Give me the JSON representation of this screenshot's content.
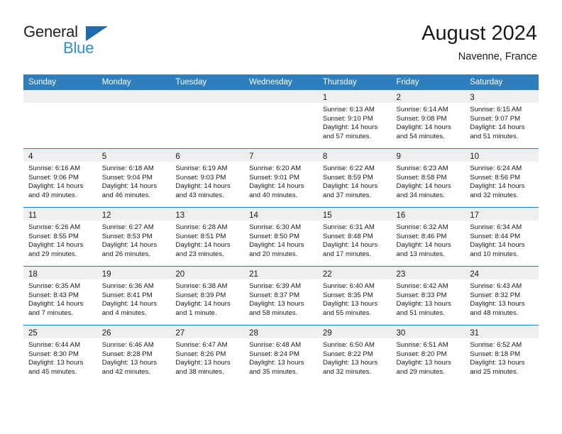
{
  "brand": {
    "name_part1": "General",
    "name_part2": "Blue",
    "triangle_color": "#1f6bb0",
    "blue_text_color": "#2e8fd6"
  },
  "header": {
    "title": "August 2024",
    "subtitle": "Navenne, France"
  },
  "theme": {
    "header_row_bg": "#2e7ebd",
    "daynum_band_bg": "#efefef",
    "grid_line": "#2e7ebd",
    "text": "#1a1a1a"
  },
  "weekday_headers": [
    "Sunday",
    "Monday",
    "Tuesday",
    "Wednesday",
    "Thursday",
    "Friday",
    "Saturday"
  ],
  "weeks": [
    [
      {
        "day": "",
        "empty": true,
        "sunrise": "",
        "sunset": "",
        "daylight_l1": "",
        "daylight_l2": ""
      },
      {
        "day": "",
        "empty": true,
        "sunrise": "",
        "sunset": "",
        "daylight_l1": "",
        "daylight_l2": ""
      },
      {
        "day": "",
        "empty": true,
        "sunrise": "",
        "sunset": "",
        "daylight_l1": "",
        "daylight_l2": ""
      },
      {
        "day": "",
        "empty": true,
        "sunrise": "",
        "sunset": "",
        "daylight_l1": "",
        "daylight_l2": ""
      },
      {
        "day": "1",
        "empty": false,
        "sunrise": "Sunrise: 6:13 AM",
        "sunset": "Sunset: 9:10 PM",
        "daylight_l1": "Daylight: 14 hours",
        "daylight_l2": "and 57 minutes."
      },
      {
        "day": "2",
        "empty": false,
        "sunrise": "Sunrise: 6:14 AM",
        "sunset": "Sunset: 9:08 PM",
        "daylight_l1": "Daylight: 14 hours",
        "daylight_l2": "and 54 minutes."
      },
      {
        "day": "3",
        "empty": false,
        "sunrise": "Sunrise: 6:15 AM",
        "sunset": "Sunset: 9:07 PM",
        "daylight_l1": "Daylight: 14 hours",
        "daylight_l2": "and 51 minutes."
      }
    ],
    [
      {
        "day": "4",
        "empty": false,
        "sunrise": "Sunrise: 6:16 AM",
        "sunset": "Sunset: 9:06 PM",
        "daylight_l1": "Daylight: 14 hours",
        "daylight_l2": "and 49 minutes."
      },
      {
        "day": "5",
        "empty": false,
        "sunrise": "Sunrise: 6:18 AM",
        "sunset": "Sunset: 9:04 PM",
        "daylight_l1": "Daylight: 14 hours",
        "daylight_l2": "and 46 minutes."
      },
      {
        "day": "6",
        "empty": false,
        "sunrise": "Sunrise: 6:19 AM",
        "sunset": "Sunset: 9:03 PM",
        "daylight_l1": "Daylight: 14 hours",
        "daylight_l2": "and 43 minutes."
      },
      {
        "day": "7",
        "empty": false,
        "sunrise": "Sunrise: 6:20 AM",
        "sunset": "Sunset: 9:01 PM",
        "daylight_l1": "Daylight: 14 hours",
        "daylight_l2": "and 40 minutes."
      },
      {
        "day": "8",
        "empty": false,
        "sunrise": "Sunrise: 6:22 AM",
        "sunset": "Sunset: 8:59 PM",
        "daylight_l1": "Daylight: 14 hours",
        "daylight_l2": "and 37 minutes."
      },
      {
        "day": "9",
        "empty": false,
        "sunrise": "Sunrise: 6:23 AM",
        "sunset": "Sunset: 8:58 PM",
        "daylight_l1": "Daylight: 14 hours",
        "daylight_l2": "and 34 minutes."
      },
      {
        "day": "10",
        "empty": false,
        "sunrise": "Sunrise: 6:24 AM",
        "sunset": "Sunset: 8:56 PM",
        "daylight_l1": "Daylight: 14 hours",
        "daylight_l2": "and 32 minutes."
      }
    ],
    [
      {
        "day": "11",
        "empty": false,
        "sunrise": "Sunrise: 6:26 AM",
        "sunset": "Sunset: 8:55 PM",
        "daylight_l1": "Daylight: 14 hours",
        "daylight_l2": "and 29 minutes."
      },
      {
        "day": "12",
        "empty": false,
        "sunrise": "Sunrise: 6:27 AM",
        "sunset": "Sunset: 8:53 PM",
        "daylight_l1": "Daylight: 14 hours",
        "daylight_l2": "and 26 minutes."
      },
      {
        "day": "13",
        "empty": false,
        "sunrise": "Sunrise: 6:28 AM",
        "sunset": "Sunset: 8:51 PM",
        "daylight_l1": "Daylight: 14 hours",
        "daylight_l2": "and 23 minutes."
      },
      {
        "day": "14",
        "empty": false,
        "sunrise": "Sunrise: 6:30 AM",
        "sunset": "Sunset: 8:50 PM",
        "daylight_l1": "Daylight: 14 hours",
        "daylight_l2": "and 20 minutes."
      },
      {
        "day": "15",
        "empty": false,
        "sunrise": "Sunrise: 6:31 AM",
        "sunset": "Sunset: 8:48 PM",
        "daylight_l1": "Daylight: 14 hours",
        "daylight_l2": "and 17 minutes."
      },
      {
        "day": "16",
        "empty": false,
        "sunrise": "Sunrise: 6:32 AM",
        "sunset": "Sunset: 8:46 PM",
        "daylight_l1": "Daylight: 14 hours",
        "daylight_l2": "and 13 minutes."
      },
      {
        "day": "17",
        "empty": false,
        "sunrise": "Sunrise: 6:34 AM",
        "sunset": "Sunset: 8:44 PM",
        "daylight_l1": "Daylight: 14 hours",
        "daylight_l2": "and 10 minutes."
      }
    ],
    [
      {
        "day": "18",
        "empty": false,
        "sunrise": "Sunrise: 6:35 AM",
        "sunset": "Sunset: 8:43 PM",
        "daylight_l1": "Daylight: 14 hours",
        "daylight_l2": "and 7 minutes."
      },
      {
        "day": "19",
        "empty": false,
        "sunrise": "Sunrise: 6:36 AM",
        "sunset": "Sunset: 8:41 PM",
        "daylight_l1": "Daylight: 14 hours",
        "daylight_l2": "and 4 minutes."
      },
      {
        "day": "20",
        "empty": false,
        "sunrise": "Sunrise: 6:38 AM",
        "sunset": "Sunset: 8:39 PM",
        "daylight_l1": "Daylight: 14 hours",
        "daylight_l2": "and 1 minute."
      },
      {
        "day": "21",
        "empty": false,
        "sunrise": "Sunrise: 6:39 AM",
        "sunset": "Sunset: 8:37 PM",
        "daylight_l1": "Daylight: 13 hours",
        "daylight_l2": "and 58 minutes."
      },
      {
        "day": "22",
        "empty": false,
        "sunrise": "Sunrise: 6:40 AM",
        "sunset": "Sunset: 8:35 PM",
        "daylight_l1": "Daylight: 13 hours",
        "daylight_l2": "and 55 minutes."
      },
      {
        "day": "23",
        "empty": false,
        "sunrise": "Sunrise: 6:42 AM",
        "sunset": "Sunset: 8:33 PM",
        "daylight_l1": "Daylight: 13 hours",
        "daylight_l2": "and 51 minutes."
      },
      {
        "day": "24",
        "empty": false,
        "sunrise": "Sunrise: 6:43 AM",
        "sunset": "Sunset: 8:32 PM",
        "daylight_l1": "Daylight: 13 hours",
        "daylight_l2": "and 48 minutes."
      }
    ],
    [
      {
        "day": "25",
        "empty": false,
        "sunrise": "Sunrise: 6:44 AM",
        "sunset": "Sunset: 8:30 PM",
        "daylight_l1": "Daylight: 13 hours",
        "daylight_l2": "and 45 minutes."
      },
      {
        "day": "26",
        "empty": false,
        "sunrise": "Sunrise: 6:46 AM",
        "sunset": "Sunset: 8:28 PM",
        "daylight_l1": "Daylight: 13 hours",
        "daylight_l2": "and 42 minutes."
      },
      {
        "day": "27",
        "empty": false,
        "sunrise": "Sunrise: 6:47 AM",
        "sunset": "Sunset: 8:26 PM",
        "daylight_l1": "Daylight: 13 hours",
        "daylight_l2": "and 38 minutes."
      },
      {
        "day": "28",
        "empty": false,
        "sunrise": "Sunrise: 6:48 AM",
        "sunset": "Sunset: 8:24 PM",
        "daylight_l1": "Daylight: 13 hours",
        "daylight_l2": "and 35 minutes."
      },
      {
        "day": "29",
        "empty": false,
        "sunrise": "Sunrise: 6:50 AM",
        "sunset": "Sunset: 8:22 PM",
        "daylight_l1": "Daylight: 13 hours",
        "daylight_l2": "and 32 minutes."
      },
      {
        "day": "30",
        "empty": false,
        "sunrise": "Sunrise: 6:51 AM",
        "sunset": "Sunset: 8:20 PM",
        "daylight_l1": "Daylight: 13 hours",
        "daylight_l2": "and 29 minutes."
      },
      {
        "day": "31",
        "empty": false,
        "sunrise": "Sunrise: 6:52 AM",
        "sunset": "Sunset: 8:18 PM",
        "daylight_l1": "Daylight: 13 hours",
        "daylight_l2": "and 25 minutes."
      }
    ]
  ]
}
